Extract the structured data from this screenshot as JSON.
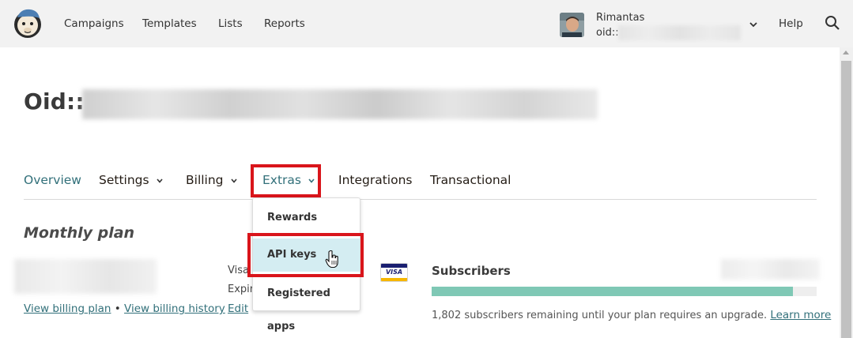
{
  "topnav": {
    "items": [
      "Campaigns",
      "Templates",
      "Lists",
      "Reports"
    ],
    "user_name": "Rimantas",
    "user_org": "oid::",
    "help": "Help",
    "colors": {
      "bar": "#f2f2f2"
    }
  },
  "page": {
    "title": "Oid::"
  },
  "tabs": [
    {
      "label": "Overview",
      "active": true
    },
    {
      "label": "Settings",
      "dropdown": true
    },
    {
      "label": "Billing",
      "dropdown": true
    },
    {
      "label": "Extras",
      "dropdown": true
    },
    {
      "label": "Integrations"
    },
    {
      "label": "Transactional"
    }
  ],
  "extras_menu": {
    "items": [
      "Rewards",
      "API keys",
      "Registered apps"
    ],
    "hovered": "API keys"
  },
  "plan": {
    "title": "Monthly plan",
    "view_billing_plan": "View billing plan",
    "separator": "•",
    "view_billing_history": "View billing history",
    "card_label_1": "Visa",
    "card_label_2": "Expir",
    "edit": "Edit",
    "card_brand": "VISA"
  },
  "subscribers": {
    "label": "Subscribers",
    "progress": 0.938,
    "message": "1,802 subscribers remaining until your plan requires an upgrade.",
    "learn_more": "Learn more"
  },
  "colors": {
    "accent": "#32707a",
    "highlight": "#d9151b",
    "progress": "#7fc8b5",
    "hover": "#d4edf2"
  }
}
